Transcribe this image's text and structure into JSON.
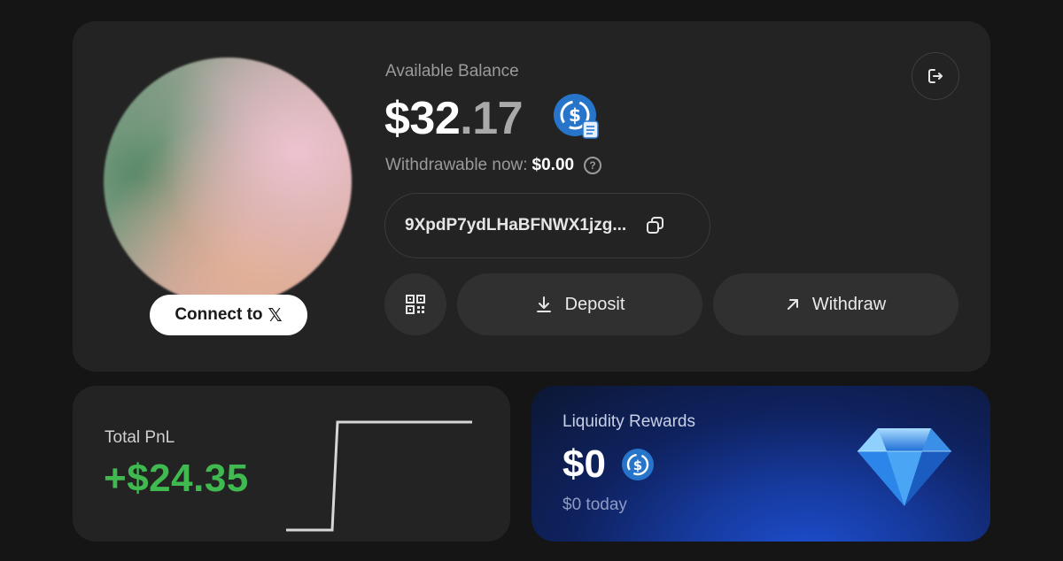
{
  "account": {
    "connect_label": "Connect to",
    "connect_icon": "x-logo-icon",
    "balance_label": "Available Balance",
    "balance_whole": "$32",
    "balance_fraction": ".17",
    "withdrawable_label": "Withdrawable now:",
    "withdrawable_value": "$0.00",
    "address": "9XpdP7ydLHaBFNWX1jzg...",
    "deposit_label": "Deposit",
    "withdraw_label": "Withdraw"
  },
  "pnl": {
    "label": "Total PnL",
    "value": "+$24.35",
    "value_color": "#3fb950"
  },
  "rewards": {
    "label": "Liquidity Rewards",
    "value": "$0",
    "today": "$0 today"
  },
  "colors": {
    "background": "#151515",
    "card": "#232323",
    "usdc_blue": "#2775ca",
    "rewards_blue": "#163a9e"
  }
}
